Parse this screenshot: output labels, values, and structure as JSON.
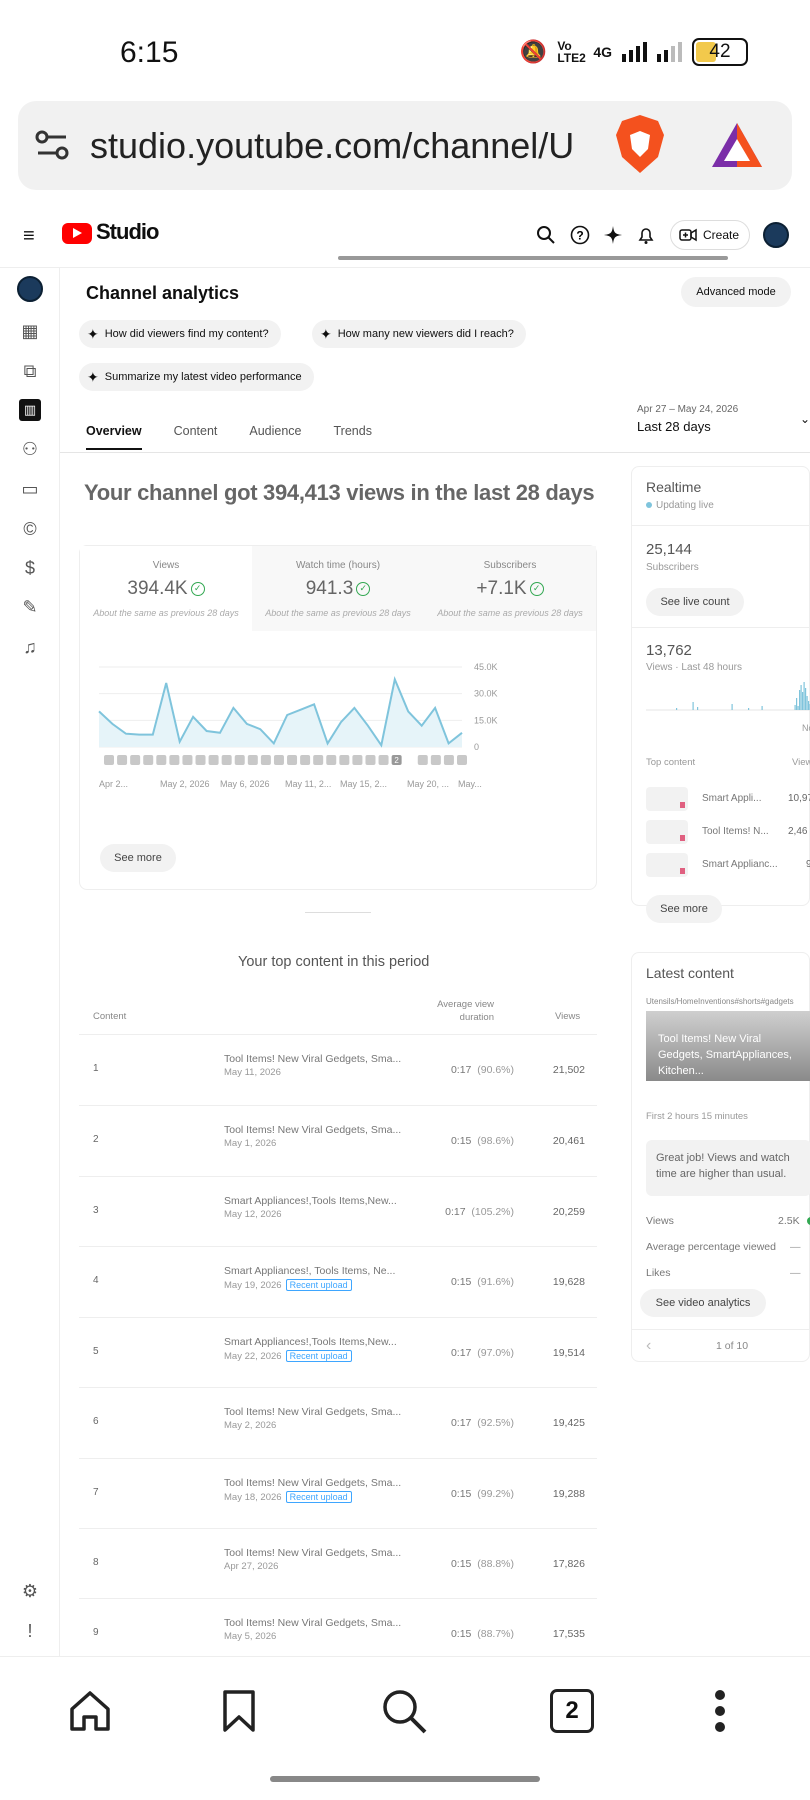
{
  "status_bar": {
    "time": "6:15",
    "network": "Vo LTE2",
    "network2": "4G",
    "battery": "42"
  },
  "browser": {
    "url": "studio.youtube.com/channel/U"
  },
  "header": {
    "logo_text": "Studio",
    "create_label": "Create"
  },
  "page": {
    "title": "Channel analytics",
    "advanced_mode": "Advanced mode",
    "chips": [
      "How did viewers find my content?",
      "How many new viewers did I reach?",
      "Summarize my latest video performance"
    ],
    "tabs": [
      "Overview",
      "Content",
      "Audience",
      "Trends"
    ],
    "date_range": "Apr 27 – May 24, 2026",
    "date_label": "Last 28 days",
    "headline": "Your channel got 394,413 views in the last 28 days"
  },
  "stats": [
    {
      "label": "Views",
      "value": "394.4K",
      "compare": "About the same as previous 28 days"
    },
    {
      "label": "Watch time (hours)",
      "value": "941.3",
      "compare": "About the same as previous 28 days"
    },
    {
      "label": "Subscribers",
      "value": "+7.1K",
      "compare": "About the same as previous 28 days"
    }
  ],
  "chart_data": {
    "type": "area",
    "y_ticks": [
      "45.0K",
      "30.0K",
      "15.0K",
      "0"
    ],
    "ylim": [
      0,
      45000
    ],
    "x_ticks": [
      "Apr 2...",
      "May 2, 2026",
      "May 6, 2026",
      "May 11, 2...",
      "May 15, 2...",
      "May 20, ...",
      "May..."
    ],
    "series": [
      {
        "values": [
          20000,
          13000,
          7500,
          7000,
          7000,
          36000,
          3000,
          17000,
          9000,
          8000,
          22000,
          13000,
          10000,
          2000,
          18000,
          21000,
          24000,
          2000,
          14000,
          22000,
          12000,
          1000,
          38000,
          20000,
          12000,
          22000,
          2000,
          8000
        ]
      }
    ],
    "marker_badge": "2",
    "grid": true,
    "color": "#7fc4dc"
  },
  "see_more": "See more",
  "realtime": {
    "title": "Realtime",
    "updating": "Updating live",
    "subs_value": "25,144",
    "subs_label": "Subscribers",
    "live_count_btn": "See live count",
    "views_value": "13,762",
    "views_label": "Views · Last 48 hours",
    "no_label": "No",
    "top_content_label": "Top content",
    "views_col": "View",
    "top_items": [
      {
        "title": "Smart Appli...",
        "views": "10,97"
      },
      {
        "title": "Tool Items! N...",
        "views": "2,46"
      },
      {
        "title": "Smart Applianc...",
        "views": "9"
      }
    ],
    "see_more": "See more"
  },
  "latest": {
    "title": "Latest content",
    "tags": "Utensils/HomeInventions#shorts#gadgets",
    "video_title": "Tool Items! New Viral Gedgets, SmartAppliances, Kitchen...",
    "first_period": "First 2 hours 15 minutes",
    "message": "Great job! Views and watch time are higher than usual.",
    "metrics": [
      {
        "label": "Views",
        "value": "2.5K"
      },
      {
        "label": "Average percentage viewed",
        "value": "—"
      },
      {
        "label": "Likes",
        "value": "—"
      }
    ],
    "analytics_btn": "See video analytics",
    "pager": "1 of 10"
  },
  "top_content": {
    "title": "Your top content in this period",
    "col_content": "Content",
    "col_duration": "Average view duration",
    "col_views": "Views",
    "recent_label": "Recent upload",
    "rows": [
      {
        "rank": "1",
        "title": "Tool Items! New Viral Gedgets, Sma...",
        "date": "May 11, 2026",
        "recent": false,
        "dur": "0:17",
        "pct": "(90.6%)",
        "views": "21,502"
      },
      {
        "rank": "2",
        "title": "Tool Items! New Viral Gedgets, Sma...",
        "date": "May 1, 2026",
        "recent": false,
        "dur": "0:15",
        "pct": "(98.6%)",
        "views": "20,461"
      },
      {
        "rank": "3",
        "title": "Smart Appliances!,Tools Items,New...",
        "date": "May 12, 2026",
        "recent": false,
        "dur": "0:17",
        "pct": "(105.2%)",
        "views": "20,259"
      },
      {
        "rank": "4",
        "title": "Smart Appliances!, Tools Items, Ne...",
        "date": "May 19, 2026",
        "recent": true,
        "dur": "0:15",
        "pct": "(91.6%)",
        "views": "19,628"
      },
      {
        "rank": "5",
        "title": "Smart Appliances!,Tools Items,New...",
        "date": "May 22, 2026",
        "recent": true,
        "dur": "0:17",
        "pct": "(97.0%)",
        "views": "19,514"
      },
      {
        "rank": "6",
        "title": "Tool Items! New Viral Gedgets, Sma...",
        "date": "May 2, 2026",
        "recent": false,
        "dur": "0:17",
        "pct": "(92.5%)",
        "views": "19,425"
      },
      {
        "rank": "7",
        "title": "Tool Items! New Viral Gedgets, Sma...",
        "date": "May 18, 2026",
        "recent": true,
        "dur": "0:15",
        "pct": "(99.2%)",
        "views": "19,288"
      },
      {
        "rank": "8",
        "title": "Tool Items! New Viral Gedgets, Sma...",
        "date": "Apr 27, 2026",
        "recent": false,
        "dur": "0:15",
        "pct": "(88.8%)",
        "views": "17,826"
      },
      {
        "rank": "9",
        "title": "Tool Items! New Viral Gedgets, Sma...",
        "date": "May 5, 2026",
        "recent": false,
        "dur": "0:15",
        "pct": "(88.7%)",
        "views": "17,535"
      }
    ]
  },
  "bottom_nav": {
    "tabs_count": "2"
  },
  "icons": [
    "menu-icon",
    "search-icon",
    "help-icon",
    "sparkle-icon",
    "bell-icon",
    "create-icon",
    "dashboard-icon",
    "content-icon",
    "analytics-icon",
    "community-icon",
    "subtitles-icon",
    "copyright-icon",
    "earn-icon",
    "customize-icon",
    "audio-library-icon",
    "settings-icon",
    "feedback-icon",
    "home-icon",
    "bookmark-icon",
    "more-icon"
  ]
}
